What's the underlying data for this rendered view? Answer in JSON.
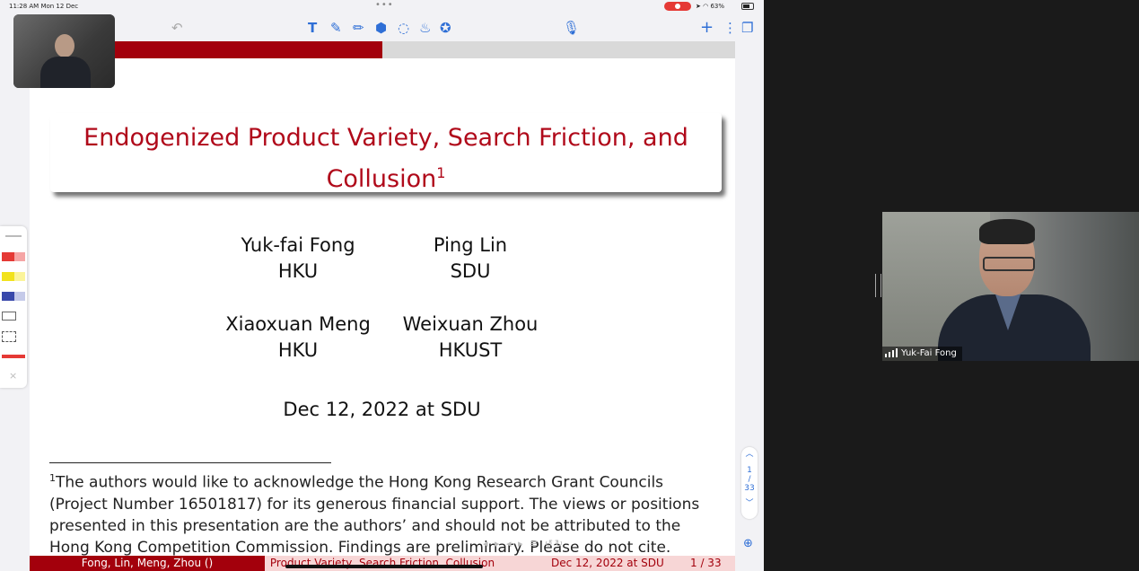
{
  "status_bar": {
    "time": "11:28 AM  Mon 12 Dec",
    "battery": "63%"
  },
  "toolbar": {
    "more_dots": "•••"
  },
  "slide": {
    "progress_fraction": 0.5,
    "title_main": "Endogenized Product Variety, Search Friction, and",
    "title_line2": "Collusion",
    "title_sup": "1",
    "authors": [
      {
        "name": "Yuk-fai Fong",
        "affil": "HKU"
      },
      {
        "name": "Ping Lin",
        "affil": "SDU"
      },
      {
        "name": "Xiaoxuan Meng",
        "affil": "HKU"
      },
      {
        "name": "Weixuan Zhou",
        "affil": "HKUST"
      }
    ],
    "date": "Dec 12, 2022 at SDU",
    "footnote_mark": "1",
    "footnote": "The authors would like to acknowledge the Hong Kong Research Grant Councils (Project Number 16501817) for its generous financial support. The views or positions presented in this presentation are the authors’ and should not be attributed to the Hong Kong Competition Commission. Findings are preliminary. Please do not cite.",
    "footer": {
      "left": "Fong, Lin, Meng, Zhou  ()",
      "center": "Product Variety, Search Friction, Collusion",
      "date": "Dec 12, 2022 at SDU",
      "page": "1 / 33"
    }
  },
  "pager": {
    "current": "1",
    "total": "33"
  },
  "video": {
    "participant_name": "Yuk-Fai Fong"
  }
}
